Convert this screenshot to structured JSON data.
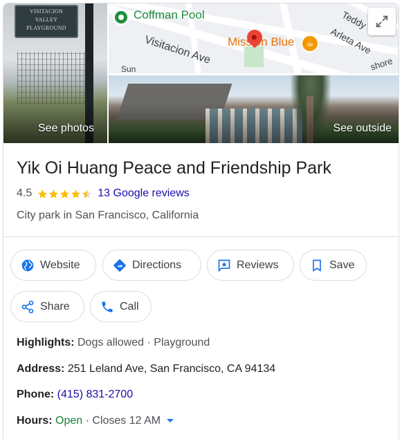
{
  "photos": {
    "left_label": "See photos",
    "right_label": "See outside",
    "sign_text": [
      "VISITACION",
      "VALLEY",
      "PLAYGROUND"
    ]
  },
  "map": {
    "labels": {
      "coffman_pool": "Coffman Pool",
      "visitacion_ave": "Visitacion Ave",
      "mission_blue": "Mission Blue",
      "teddy": "Teddy",
      "arleta_ave": "Arleta Ave",
      "sun": "Sun",
      "shore": "shore"
    },
    "expand_icon": "expand-icon"
  },
  "place": {
    "title": "Yik Oi Huang Peace and Friendship Park",
    "rating": "4.5",
    "stars": 4.5,
    "reviews_link": "13 Google reviews",
    "category": "City park in San Francisco, California"
  },
  "actions": {
    "website": "Website",
    "directions": "Directions",
    "reviews": "Reviews",
    "save": "Save",
    "share": "Share",
    "call": "Call"
  },
  "details": {
    "highlights_label": "Highlights:",
    "highlights_value": "Dogs allowed · Playground",
    "address_label": "Address:",
    "address_value": "251 Leland Ave, San Francisco, CA 94134",
    "phone_label": "Phone:",
    "phone_value": "(415) 831-2700",
    "hours_label": "Hours:",
    "hours_open": "Open",
    "hours_close": "· Closes 12 AM"
  },
  "colors": {
    "link": "#1a0dab",
    "open": "#188038",
    "star": "#fbbc04",
    "accent": "#1a73e8"
  }
}
